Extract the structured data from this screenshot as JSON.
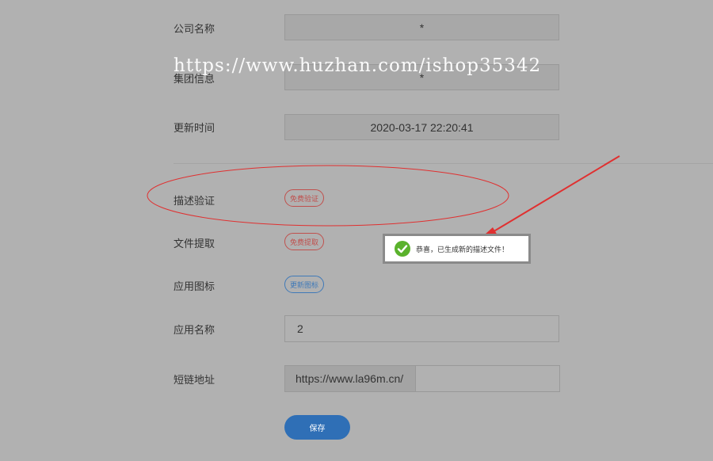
{
  "form": {
    "company_name": {
      "label": "公司名称",
      "value": "*"
    },
    "group_info": {
      "label": "集团信息",
      "value": "*"
    },
    "update_time": {
      "label": "更新时间",
      "value": "2020-03-17 22:20:41"
    },
    "desc_verify": {
      "label": "描述验证",
      "button": "免费验证"
    },
    "file_extract": {
      "label": "文件提取",
      "button": "免费提取"
    },
    "app_icon": {
      "label": "应用图标",
      "button": "更新图标"
    },
    "app_name": {
      "label": "应用名称",
      "value": "2"
    },
    "short_link": {
      "label": "短链地址",
      "prefix": "https://www.la96m.cn/",
      "value": ""
    },
    "save_label": "保存"
  },
  "toast": {
    "message": "恭喜，已生成新的描述文件！",
    "icon": "check-circle-icon",
    "icon_color": "#5ab22c"
  },
  "watermark": "https://www.huzhan.com/ishop35342",
  "annotations": {
    "color": "#e03030"
  },
  "colors": {
    "background": "#b1b1b1",
    "primary": "#2f6fb6",
    "danger": "#c0504d",
    "info": "#3f79b8"
  }
}
